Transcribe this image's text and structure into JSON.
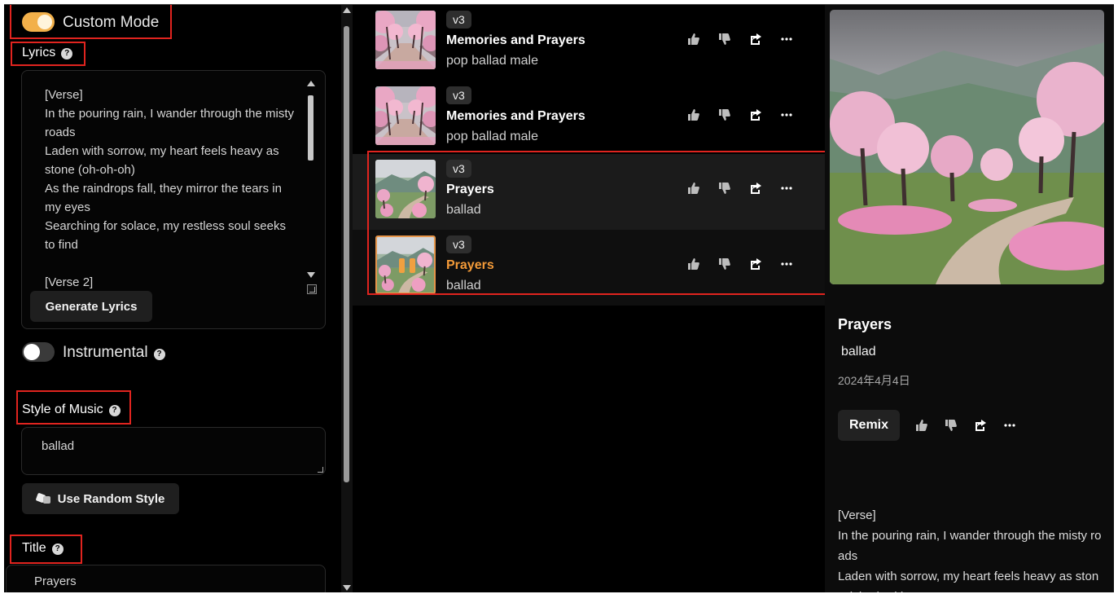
{
  "left": {
    "custom_mode_label": "Custom Mode",
    "lyrics_label": "Lyrics",
    "lyrics_text": "[Verse]\nIn the pouring rain, I wander through the misty roads\nLaden with sorrow, my heart feels heavy as stone (oh-oh-oh)\nAs the raindrops fall, they mirror the tears in my eyes\nSearching for solace, my restless soul seeks to find\n\n[Verse 2]",
    "generate_lyrics_label": "Generate Lyrics",
    "instrumental_label": "Instrumental",
    "style_label": "Style of Music",
    "style_value": "ballad",
    "random_style_label": "Use Random Style",
    "title_label": "Title",
    "title_value": "Prayers"
  },
  "songs": [
    {
      "version": "v3",
      "title": "Memories and Prayers",
      "style": "pop ballad male"
    },
    {
      "version": "v3",
      "title": "Memories and Prayers",
      "style": "pop ballad male"
    },
    {
      "version": "v3",
      "title": "Prayers",
      "style": "ballad"
    },
    {
      "version": "v3",
      "title": "Prayers",
      "style": "ballad"
    }
  ],
  "detail": {
    "title": "Prayers",
    "style": "ballad",
    "date": "2024年4月4日",
    "remix_label": "Remix",
    "lyrics": "[Verse]\nIn the pouring rain, I wander through the misty roads\nLaden with sorrow, my heart feels heavy as stone (oh-oh-oh)"
  },
  "colors": {
    "accent_orange": "#f39a38",
    "toggle_on": "#f2b04a",
    "highlight_red": "#e0241f",
    "background": "#000000"
  },
  "icons": [
    "thumbs-up-icon",
    "thumbs-down-icon",
    "share-icon",
    "more-icon",
    "dice-icon",
    "help-icon",
    "pause-icon"
  ]
}
